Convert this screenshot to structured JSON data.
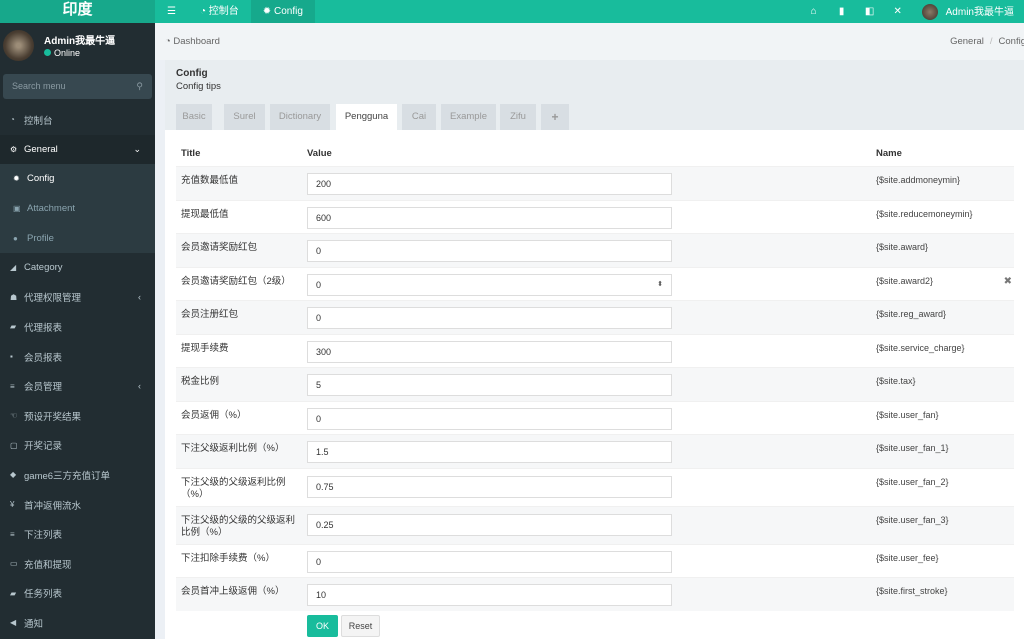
{
  "app": {
    "logo": "印度",
    "accent": "#18bc9c"
  },
  "topbar": {
    "menu_icon": "bars-icon",
    "tabs": [
      {
        "icon": "dashboard-icon",
        "label": "控制台"
      },
      {
        "icon": "gear-icon",
        "label": "Config"
      }
    ],
    "icons": [
      "home-icon",
      "trash-icon",
      "language-icon",
      "fullscreen-icon"
    ],
    "user": "Admin我最牛逼"
  },
  "sidebar": {
    "user": {
      "name": "Admin我最牛逼",
      "status": "Online"
    },
    "search_placeholder": "Search menu",
    "items": [
      {
        "icon": "dashboard-icon",
        "label": "控制台"
      },
      {
        "icon": "cogs-icon",
        "label": "General",
        "open": true,
        "sub": [
          {
            "icon": "gear-icon",
            "label": "Config",
            "active": true
          },
          {
            "icon": "file-image-icon",
            "label": "Attachment"
          },
          {
            "icon": "user-icon",
            "label": "Profile"
          }
        ]
      },
      {
        "icon": "leaf-icon",
        "label": "Category"
      },
      {
        "icon": "users-icon",
        "label": "代理权限管理",
        "arrow": true
      },
      {
        "icon": "book-icon",
        "label": "代理报表"
      },
      {
        "icon": "address-book-icon",
        "label": "会员报表"
      },
      {
        "icon": "list-icon",
        "label": "会员管理",
        "arrow": true
      },
      {
        "icon": "hand-icon",
        "label": "预设开奖结果"
      },
      {
        "icon": "calendar-check-icon",
        "label": "开奖记录"
      },
      {
        "icon": "diamond-icon",
        "label": "game6三方充值订单"
      },
      {
        "icon": "yen-icon",
        "label": "首冲返佣流水"
      },
      {
        "icon": "list-icon",
        "label": "下注列表"
      },
      {
        "icon": "money-icon",
        "label": "充值和提现"
      },
      {
        "icon": "book-icon",
        "label": "任务列表"
      },
      {
        "icon": "bullhorn-icon",
        "label": "通知"
      }
    ]
  },
  "breadcrumb": {
    "home": "Dashboard",
    "trail": [
      "General",
      "Config"
    ]
  },
  "panel": {
    "title": "Config",
    "tips": "Config tips",
    "tabs": [
      "Basic",
      "Surel",
      "Dictionary",
      "Pengguna",
      "Cai",
      "Example",
      "Zifu",
      "+"
    ],
    "active_tab": "Pengguna"
  },
  "table": {
    "headers": {
      "title": "Title",
      "value": "Value",
      "name": "Name"
    },
    "rows": [
      {
        "title": "充值数最低值",
        "value": "200",
        "name": "{$site.addmoneymin}"
      },
      {
        "title": "提现最低值",
        "value": "600",
        "name": "{$site.reducemoneymin}"
      },
      {
        "title": "会员邀请奖励红包",
        "value": "0",
        "name": "{$site.award}"
      },
      {
        "title": "会员邀请奖励红包（2级）",
        "value": "0",
        "name": "{$site.award2}",
        "focused": true
      },
      {
        "title": "会员注册红包",
        "value": "0",
        "name": "{$site.reg_award}"
      },
      {
        "title": "提现手续费",
        "value": "300",
        "name": "{$site.service_charge}"
      },
      {
        "title": "税金比例",
        "value": "5",
        "name": "{$site.tax}"
      },
      {
        "title": "会员返佣（%）",
        "value": "0",
        "name": "{$site.user_fan}"
      },
      {
        "title": "下注父级返利比例（%）",
        "value": "1.5",
        "name": "{$site.user_fan_1}"
      },
      {
        "title": "下注父级的父级返利比例（%）",
        "value": "0.75",
        "name": "{$site.user_fan_2}"
      },
      {
        "title": "下注父级的父级的父级返利比例（%）",
        "value": "0.25",
        "name": "{$site.user_fan_3}"
      },
      {
        "title": "下注扣除手续费（%）",
        "value": "0",
        "name": "{$site.user_fee}"
      },
      {
        "title": "会员首冲上级返佣（%）",
        "value": "10",
        "name": "{$site.first_stroke}"
      }
    ]
  },
  "buttons": {
    "ok": "OK",
    "reset": "Reset"
  }
}
